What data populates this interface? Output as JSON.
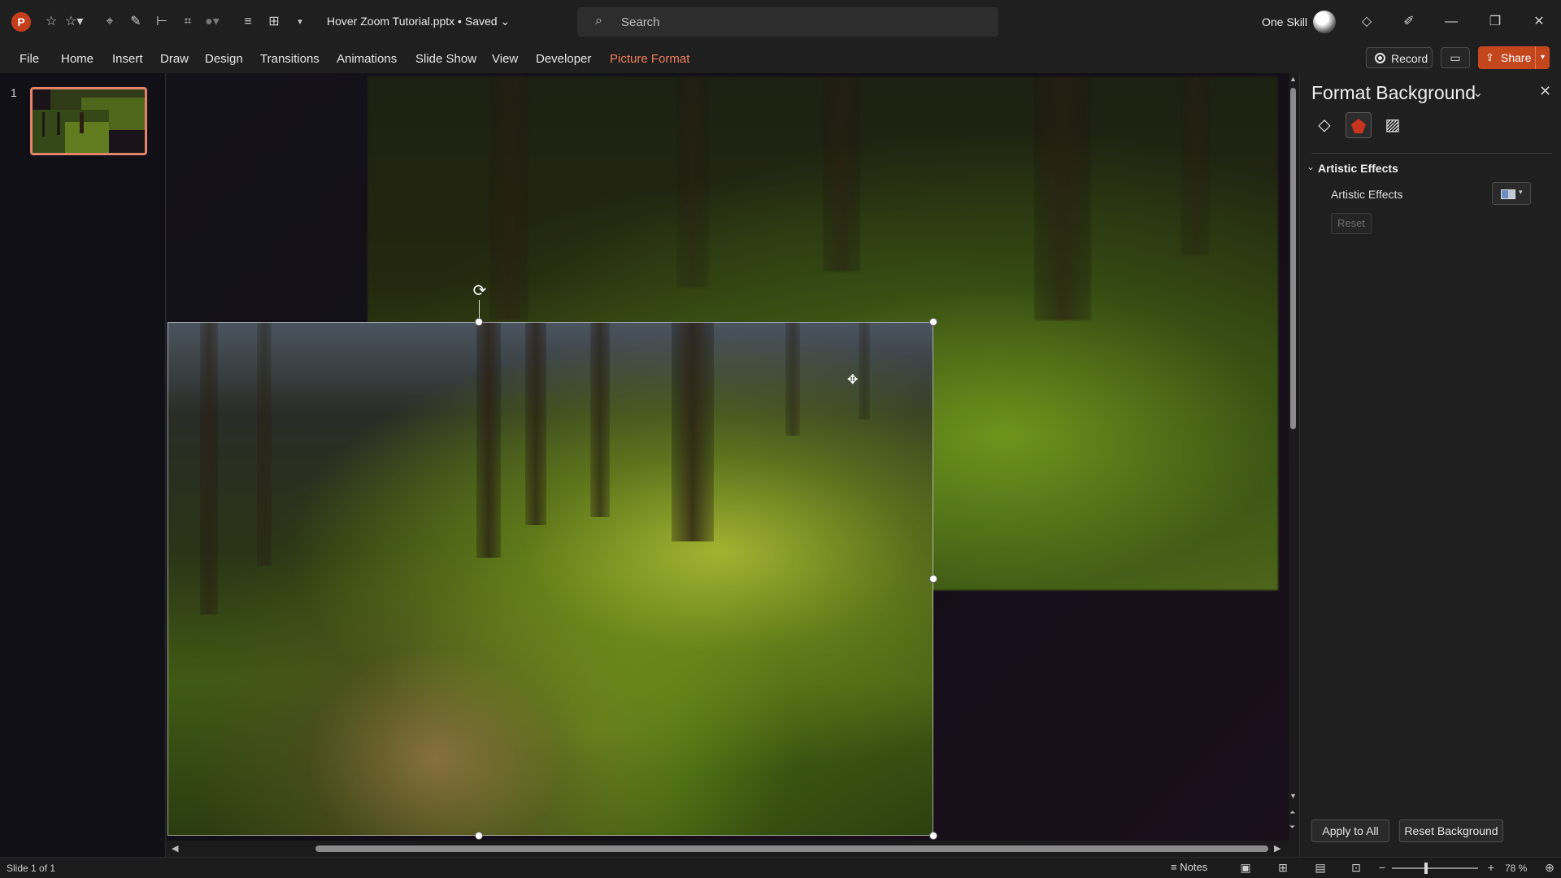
{
  "titlebar": {
    "app_logo": "P",
    "doc_title": "Hover Zoom Tutorial.pptx • Saved",
    "search_placeholder": "Search",
    "user_name": "One Skill",
    "icons": [
      "star-outline-icon",
      "star-dropdown-icon",
      "shape-icon",
      "pen-icon",
      "align-icon",
      "crop-icon",
      "color-icon",
      "distribute-icon",
      "group-icon",
      "customize-qat-icon"
    ]
  },
  "ribbon": {
    "tabs": [
      "File",
      "Home",
      "Insert",
      "Draw",
      "Design",
      "Transitions",
      "Animations",
      "Slide Show",
      "View",
      "Developer",
      "Picture Format"
    ],
    "active_tab": "Picture Format",
    "record_label": "Record",
    "share_label": "Share"
  },
  "thumbnails": {
    "slide_number": "1"
  },
  "format_pane": {
    "title": "Format Background",
    "section_title": "Artistic Effects",
    "effects_label": "Artistic Effects",
    "reset_label": "Reset",
    "apply_all_label": "Apply to All",
    "reset_background_label": "Reset Background",
    "tab_icons": [
      "fill-icon",
      "effects-icon",
      "picture-icon"
    ]
  },
  "statusbar": {
    "slide_count": "Slide 1 of 1",
    "notes_label": "Notes",
    "zoom": "78 %"
  },
  "colors": {
    "accent": "#c4461d",
    "active_tab": "#f07f5a"
  }
}
